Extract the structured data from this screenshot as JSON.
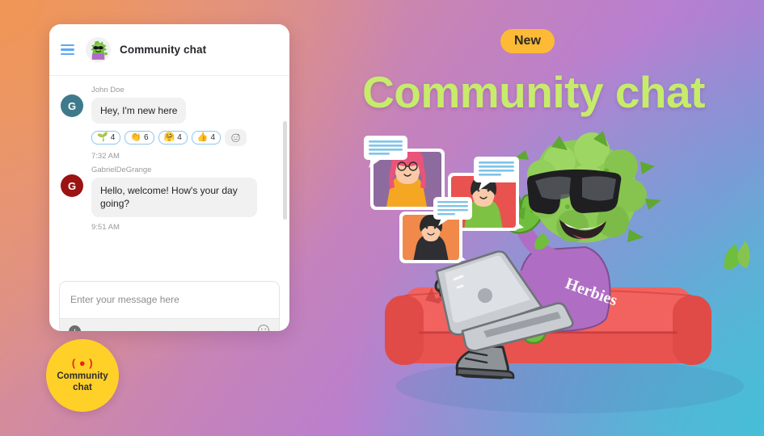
{
  "background": {
    "gradient_from": "#e89a6a",
    "gradient_mid": "#bd80c9",
    "gradient_to": "#5eb8d8"
  },
  "chat_panel": {
    "header": {
      "menu_icon": "hamburger-menu-icon",
      "avatar_alt": "green-plant-mascot-avatar",
      "title": "Community chat"
    },
    "messages": [
      {
        "author": "John Doe",
        "avatar_initial": "G",
        "avatar_color": "#3E7A8C",
        "text": "Hey, I'm new here",
        "time": "7:32 AM",
        "reactions": [
          {
            "emoji": "🌱",
            "name": "seedling-reaction",
            "count": "4"
          },
          {
            "emoji": "👏",
            "name": "clap-reaction",
            "count": "6"
          },
          {
            "emoji": "🤗",
            "name": "hugging-face-reaction",
            "count": "4"
          },
          {
            "emoji": "👍",
            "name": "thumbs-up-reaction",
            "count": "4"
          }
        ],
        "add_reaction_icon": "add-reaction-smiley-icon"
      },
      {
        "author": "GabrielDeGrange",
        "avatar_initial": "G",
        "avatar_color": "#9B1313",
        "text": "Hello, welcome! How's your day going?",
        "time": "9:51 AM",
        "reactions": []
      }
    ],
    "composer": {
      "placeholder": "Enter your message here",
      "value": "",
      "attach_icon": "plus-icon",
      "emoji_icon": "smiley-icon"
    }
  },
  "badge": {
    "live_icon": "( ● )",
    "line1": "Community",
    "line2": "chat",
    "color": "#FFD028"
  },
  "hero": {
    "new_label": "New",
    "new_color": "#FCBA36",
    "title": "Community chat",
    "title_color": "#C7EB6B"
  },
  "illustration": {
    "name": "community-chat-illustration",
    "mascot_shirt_text": "Herbies",
    "cards": [
      {
        "name": "chat-card-pink-haired-person",
        "bg": "#8E6B9E",
        "shirt": "#F5A623"
      },
      {
        "name": "chat-card-green-shirt-person",
        "bg": "#E8524F",
        "shirt": "#7DC242"
      },
      {
        "name": "chat-card-black-shirt-person",
        "bg": "#F0894A",
        "shirt": "#2E2E33"
      }
    ],
    "couch_color": "#E8524F",
    "mascot_color": "#7DC242"
  }
}
